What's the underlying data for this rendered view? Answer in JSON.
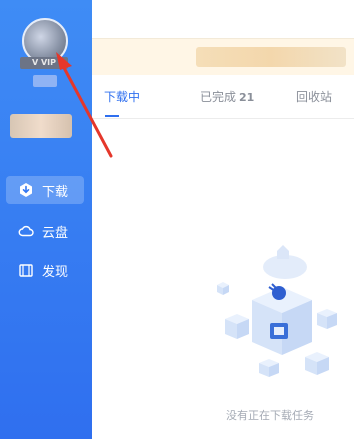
{
  "user": {
    "vip_badge": "V VIP"
  },
  "sidebar": {
    "items": [
      {
        "icon": "download-icon",
        "label": "下载",
        "active": true
      },
      {
        "icon": "cloud-icon",
        "label": "云盘",
        "active": false
      },
      {
        "icon": "discover-icon",
        "label": "发现",
        "active": false
      }
    ]
  },
  "tabs": [
    {
      "label": "下载中",
      "active": true
    },
    {
      "label": "已完成",
      "count": "21",
      "active": false
    },
    {
      "label": "回收站",
      "active": false
    }
  ],
  "empty_state": {
    "text": "没有正在下载任务",
    "illustration": "cube-plug-illustration"
  },
  "colors": {
    "sidebar": "#3478f2",
    "accent": "#2f6fef",
    "notice_bg": "#fff6e6",
    "arrow": "#e5372b"
  }
}
